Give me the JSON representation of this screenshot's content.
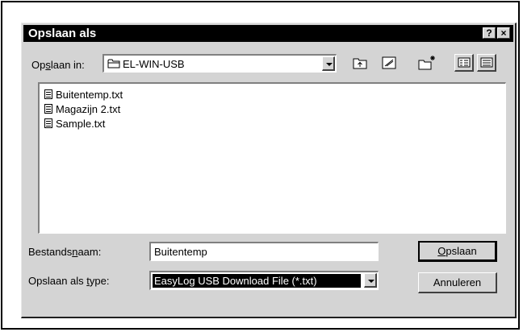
{
  "dialog": {
    "title": "Opslaan als",
    "help_button": "?",
    "close_button": "×"
  },
  "save_in": {
    "label_pre": "Op",
    "label_accel": "s",
    "label_post": "laan in:",
    "value": "EL-WIN-USB"
  },
  "files": [
    {
      "name": "Buitentemp.txt"
    },
    {
      "name": "Magazijn 2.txt"
    },
    {
      "name": "Sample.txt"
    }
  ],
  "filename": {
    "label_pre": "Bestands",
    "label_accel": "n",
    "label_post": "aam:",
    "value": "Buitentemp"
  },
  "filetype": {
    "label_pre": "Opslaan als ",
    "label_accel": "t",
    "label_post": "ype:",
    "value": "EasyLog USB Download File (*.txt)"
  },
  "buttons": {
    "save_accel": "O",
    "save_rest": "pslaan",
    "cancel": "Annuleren"
  },
  "toolbar_icons": [
    "up-folder-icon",
    "desktop-icon",
    "new-folder-icon",
    "list-view-icon",
    "details-view-icon"
  ]
}
